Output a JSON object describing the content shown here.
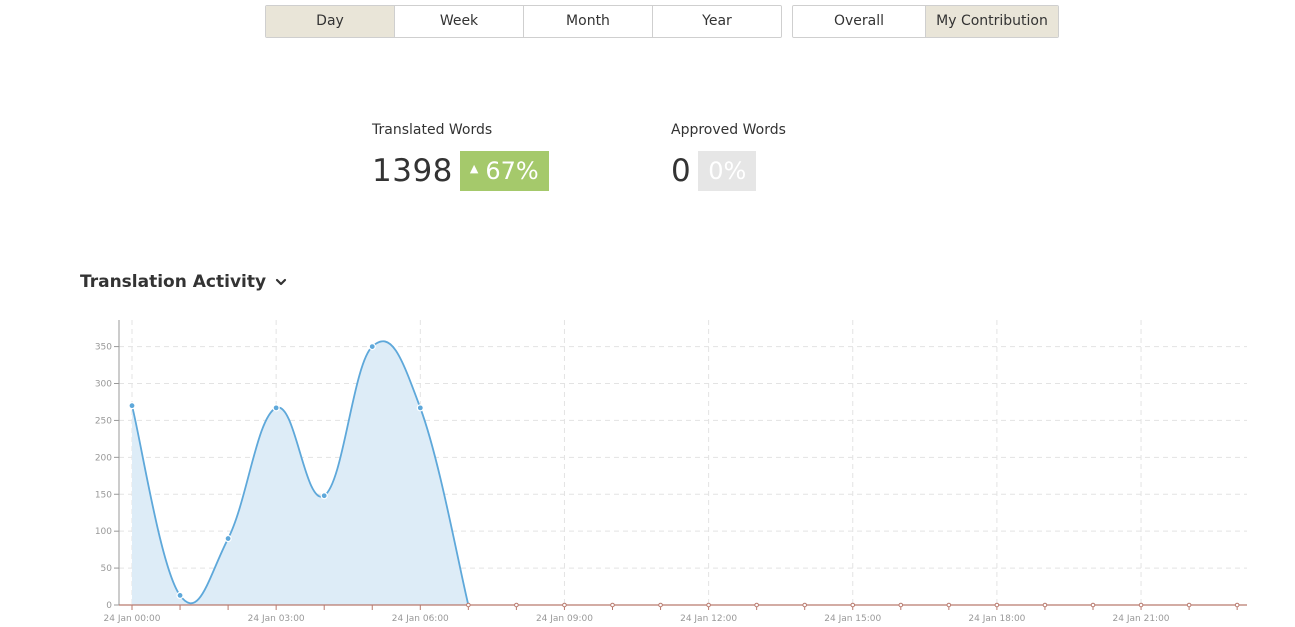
{
  "toolbar": {
    "period_buttons": [
      {
        "label": "Day",
        "active": true
      },
      {
        "label": "Week",
        "active": false
      },
      {
        "label": "Month",
        "active": false
      },
      {
        "label": "Year",
        "active": false
      }
    ],
    "scope_buttons": [
      {
        "label": "Overall",
        "active": false
      },
      {
        "label": "My Contribution",
        "active": true
      }
    ]
  },
  "stats": {
    "translated": {
      "label": "Translated Words",
      "value": "1398",
      "change": "67%",
      "direction": "up"
    },
    "approved": {
      "label": "Approved Words",
      "value": "0",
      "change": "0%"
    }
  },
  "section": {
    "title": "Translation Activity",
    "toggle_icon": "chevron-down-icon"
  },
  "colors": {
    "active_button": "#e9e5d8",
    "badge_up": "#a5c96b",
    "badge_neutral": "#e6e6e6",
    "series_line": "#5ea8da",
    "series_fill": "#ddecf7",
    "baseline": "#b97a6e"
  },
  "chart_data": {
    "type": "area",
    "title": "",
    "xlabel": "",
    "ylabel": "",
    "ylim": [
      0,
      385
    ],
    "yticks": [
      0,
      50,
      100,
      150,
      200,
      250,
      300,
      350
    ],
    "grid": true,
    "x_hours": [
      0,
      1,
      2,
      3,
      4,
      5,
      6,
      7,
      8,
      9,
      10,
      11,
      12,
      13,
      14,
      15,
      16,
      17,
      18,
      19,
      20,
      21,
      22,
      23
    ],
    "xtick_hours": [
      0,
      3,
      6,
      9,
      12,
      15,
      18,
      21
    ],
    "xtick_labels": [
      "24 Jan 00:00",
      "24 Jan 03:00",
      "24 Jan 06:00",
      "24 Jan 09:00",
      "24 Jan 12:00",
      "24 Jan 15:00",
      "24 Jan 18:00",
      "24 Jan 21:00"
    ],
    "series": [
      {
        "values": [
          270,
          13,
          90,
          267,
          148,
          350,
          267,
          0
        ],
        "end_hour": 7
      }
    ]
  }
}
